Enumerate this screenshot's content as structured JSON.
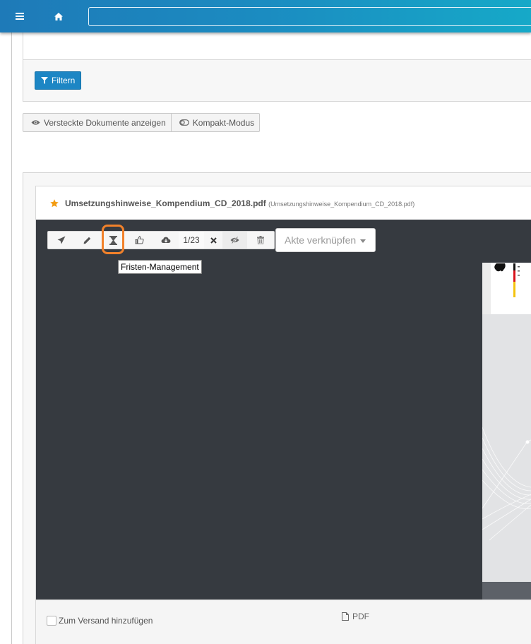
{
  "topbar": {
    "menu_icon": "hamburger-menu-icon",
    "home_icon": "home-icon",
    "search_value": ""
  },
  "filter": {
    "label": "Filtern",
    "icon": "filter-icon"
  },
  "view_toggles": {
    "hidden_docs_label": "Versteckte Dokumente anzeigen",
    "compact_label": "Kompakt-Modus"
  },
  "document": {
    "title": "Umsetzungshinweise_Kompendium_CD_2018.pdf",
    "filename": "(Umsetzungshinweise_Kompendium_CD_2018.pdf)",
    "starred": true,
    "accent_color": "#f39c12"
  },
  "toolbar": {
    "page_indicator": "1/23",
    "tooltip": "Fristen-Management",
    "akte_label": "Akte verknüpfen",
    "highlight_color": "#f2812a"
  },
  "footer": {
    "checkbox_label": "Zum Versand hinzufügen",
    "format_label": "PDF"
  },
  "colors": {
    "topbar_start": "#1e7ab8",
    "topbar_end": "#16a9c8",
    "primary_button": "#1d86c4",
    "viewer_bg": "#363a40"
  }
}
